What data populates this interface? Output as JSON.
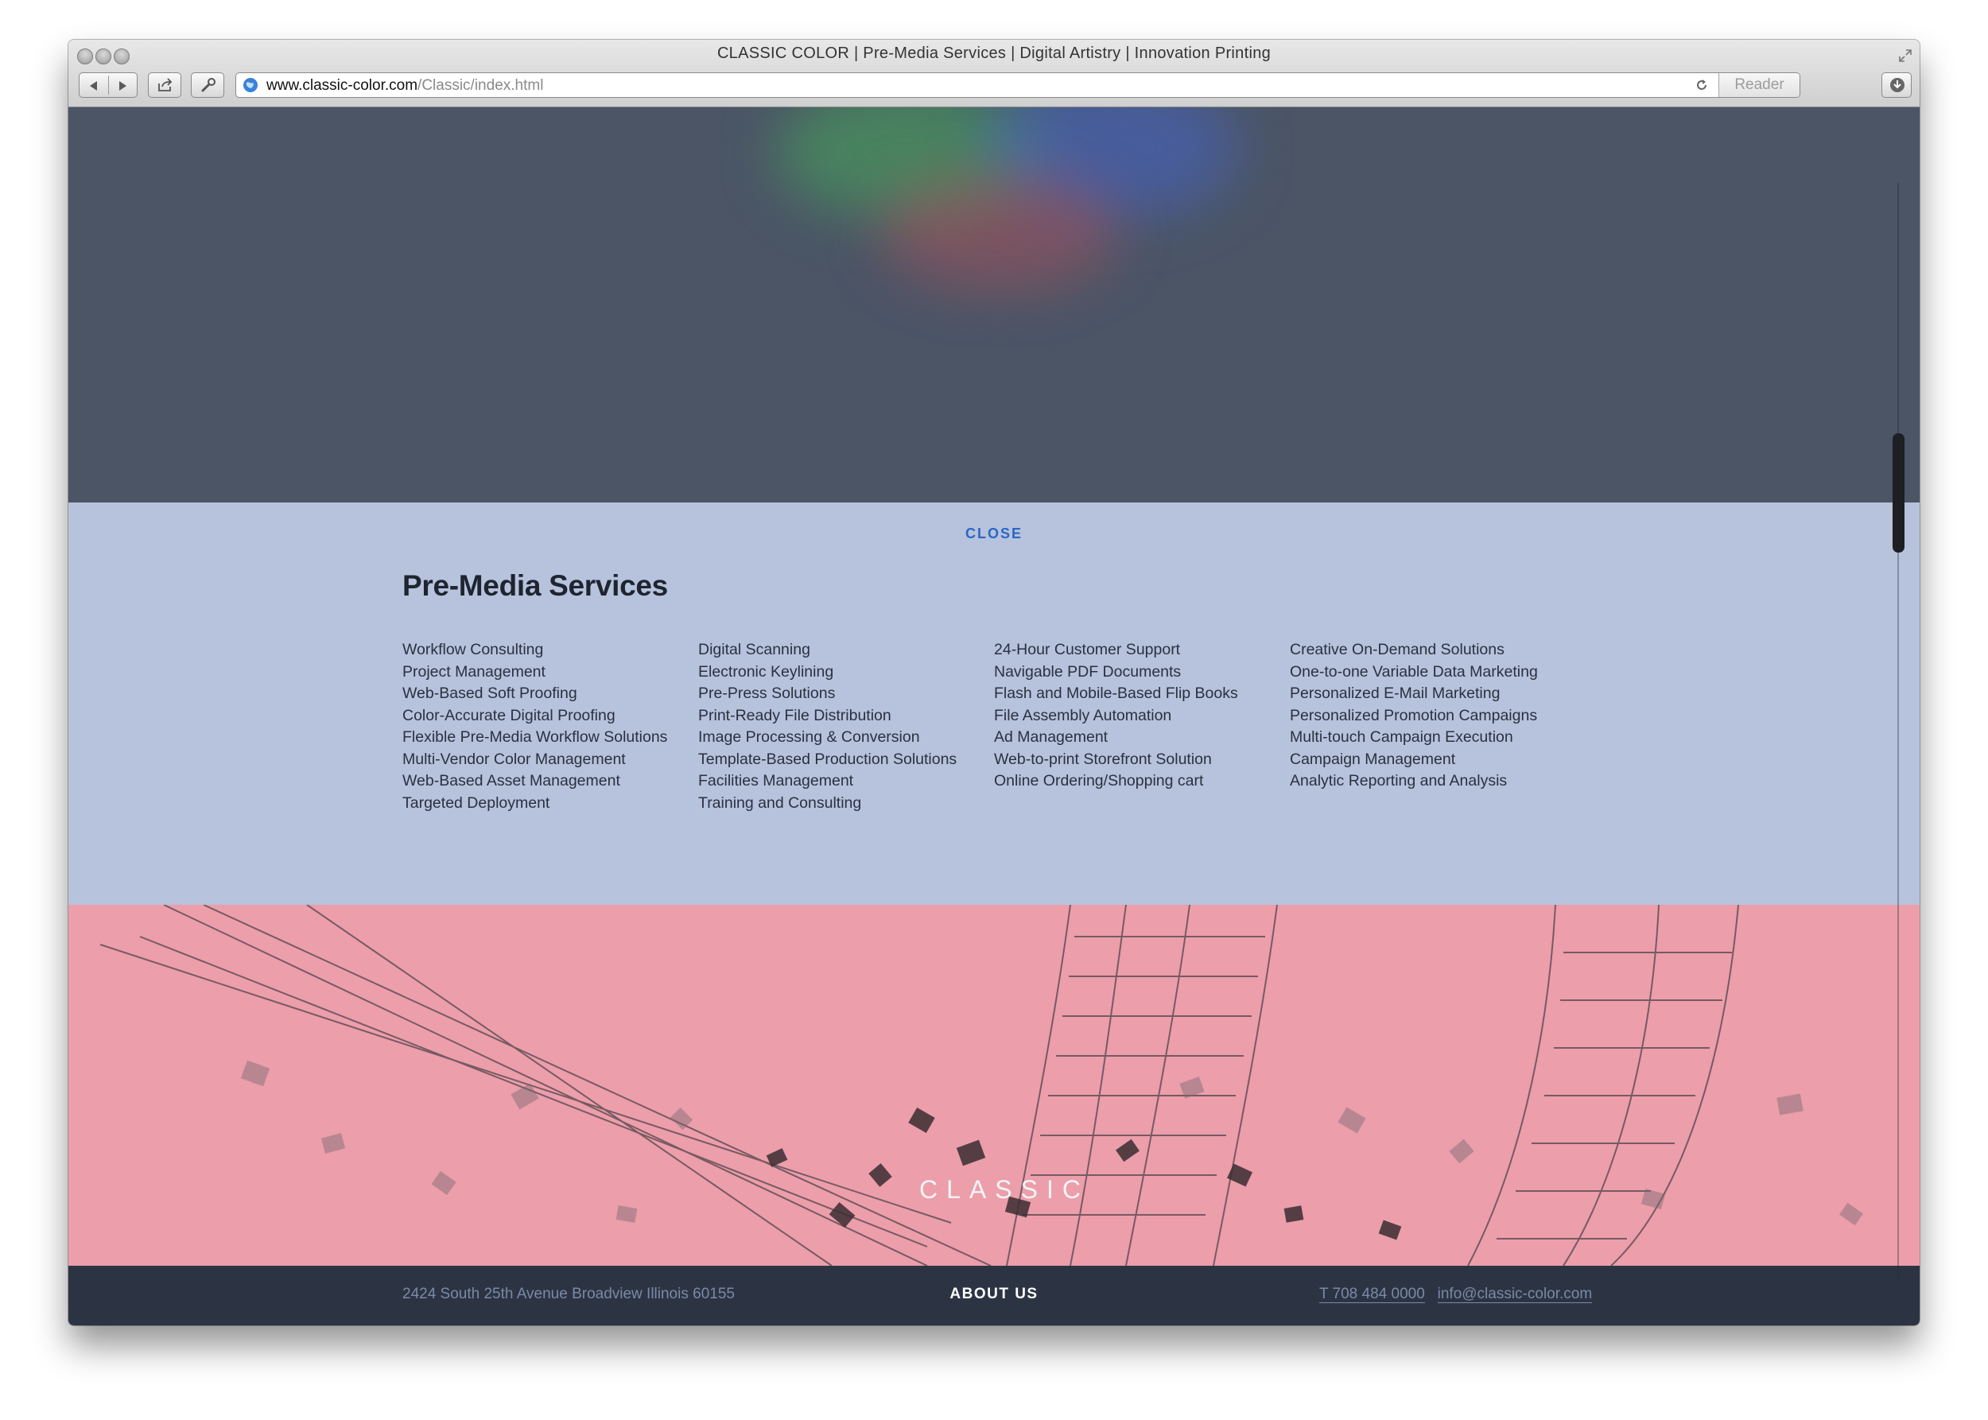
{
  "window": {
    "title": "CLASSIC COLOR | Pre-Media Services | Digital Artistry | Innovation Printing",
    "url_domain": "www.classic-color.com",
    "url_path": "/Classic/index.html",
    "reader_label": "Reader"
  },
  "icons": {
    "traffic_lights": "traffic-light-icon",
    "back": "back-arrow-icon",
    "forward": "forward-arrow-icon",
    "share": "share-icon",
    "settings": "wrench-icon",
    "site": "globe-icon",
    "reload": "reload-icon",
    "downloads": "download-icon",
    "fullscreen": "fullscreen-icon"
  },
  "colors": {
    "hero_bg": "#4b5566",
    "panel_bg": "#b7c3dc",
    "banner_bg": "#ec9eab",
    "footer_bg": "#2c3444",
    "link": "#2a66c7"
  },
  "panel": {
    "close_label": "CLOSE",
    "title": "Pre-Media Services",
    "columns": [
      [
        "Workflow Consulting",
        "Project Management",
        "Web-Based Soft Proofing",
        "Color-Accurate Digital Proofing",
        "Flexible Pre-Media Workflow Solutions",
        "Multi-Vendor Color Management",
        "Web-Based Asset Management",
        "Targeted Deployment"
      ],
      [
        "Digital Scanning",
        "Electronic Keylining",
        "Pre-Press Solutions",
        "Print-Ready File Distribution",
        "Image Processing & Conversion",
        "Template-Based Production Solutions",
        "Facilities Management",
        "Training and Consulting"
      ],
      [
        "24-Hour Customer Support",
        "Navigable PDF Documents",
        "Flash and Mobile-Based Flip Books",
        "File Assembly Automation",
        "Ad Management",
        "Web-to-print Storefront Solution",
        "Online Ordering/Shopping cart"
      ],
      [
        "Creative On-Demand Solutions",
        "One-to-one Variable Data Marketing",
        "Personalized E-Mail Marketing",
        "Personalized Promotion Campaigns",
        "Multi-touch Campaign Execution",
        "Campaign Management",
        "Analytic Reporting and Analysis"
      ]
    ]
  },
  "banner": {
    "logo_text": "CLASSIC"
  },
  "footer": {
    "address": "2424 South 25th Avenue   Broadview Illinois 60155",
    "about_label": "ABOUT US",
    "phone": "T 708 484 0000",
    "email": "info@classic-color.com"
  }
}
